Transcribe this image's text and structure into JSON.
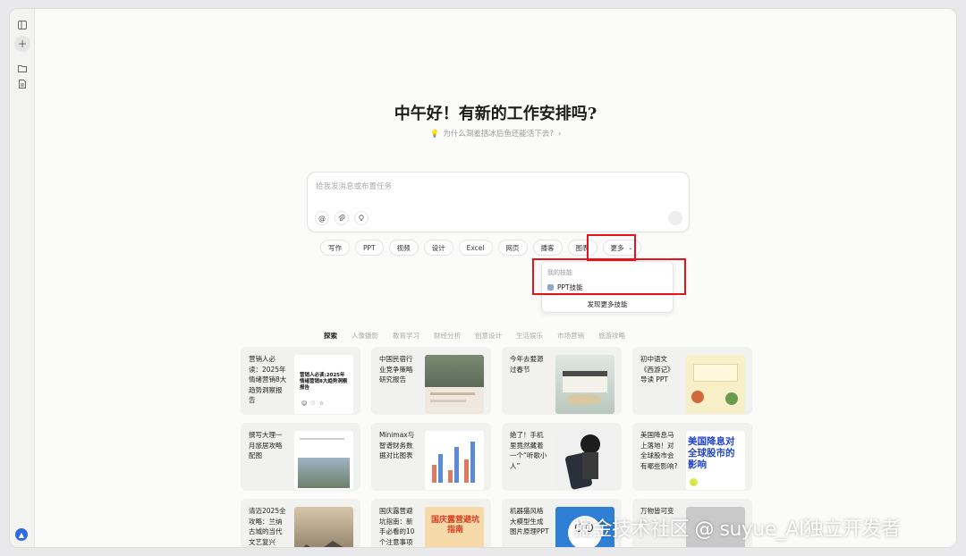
{
  "greeting": "中午好！有新的工作安排吗?",
  "sub_prompt": "为什么涮羞括冰后鱼还能活下去?",
  "input": {
    "placeholder": "给我发消息或布置任务"
  },
  "chips": [
    "写作",
    "PPT",
    "视频",
    "设计",
    "Excel",
    "网页",
    "播客",
    "图表"
  ],
  "more_chip": "更多",
  "dropdown": {
    "heading": "我的技能",
    "item": "PPT技能",
    "footer": "发现更多技能"
  },
  "tabs": [
    "探索",
    "人像摄影",
    "教育学习",
    "财经分析",
    "创意设计",
    "生活娱乐",
    "市场营销",
    "旅游攻略"
  ],
  "cards": [
    {
      "text": "营销人必读：2025年情绪营销8大趋势洞察报告",
      "thumb": "report-cover-thumbnail",
      "thumb_title": "营销人必读:2025年情绪营销8大趋势洞察报告"
    },
    {
      "text": "中国民宿行业竞争策略研究报告",
      "thumb": "homestay-report-thumbnail"
    },
    {
      "text": "今年去婺源过春节",
      "thumb": "wuyuan-village-thumbnail"
    },
    {
      "text": "初中语文《西游记》导读 PPT",
      "thumb": "journey-west-slide-thumbnail"
    },
    {
      "text": "撰写大理一月旅居攻略配图",
      "thumb": "dali-building-thumbnail"
    },
    {
      "text": "Minimax与智谱财务数据对比图表",
      "thumb": "bar-chart-thumbnail"
    },
    {
      "text": "绝了！手机里竟然藏着一个“听歌小人”",
      "thumb": "phone-figure-thumbnail"
    },
    {
      "text": "美国降息马上落地！对全球股市会有哪些影响?",
      "thumb": "rate-cut-poster-thumbnail",
      "thumb_title": "美国降息对全球股市的影响"
    },
    {
      "text": "清迈2025全攻略：兰纳古城的当代文艺复兴",
      "thumb": "chiangmai-mountain-thumbnail"
    },
    {
      "text": "国庆露营避坑指南：新手必看的10个注意事项",
      "thumb": "camping-guide-thumbnail",
      "thumb_title": "国庆露营避坑指南"
    },
    {
      "text": "机器猫风格大模型生成图片原理PPT",
      "thumb": "doraemon-thumbnail"
    },
    {
      "text": "万物皆可变",
      "thumb": "transform-thumbnail"
    }
  ],
  "watermark": "掘金技术社区 @ suyue_AI独立开发者",
  "colors": {
    "accent_red": "#e3141b",
    "avatar_blue": "#2f6bd9"
  }
}
